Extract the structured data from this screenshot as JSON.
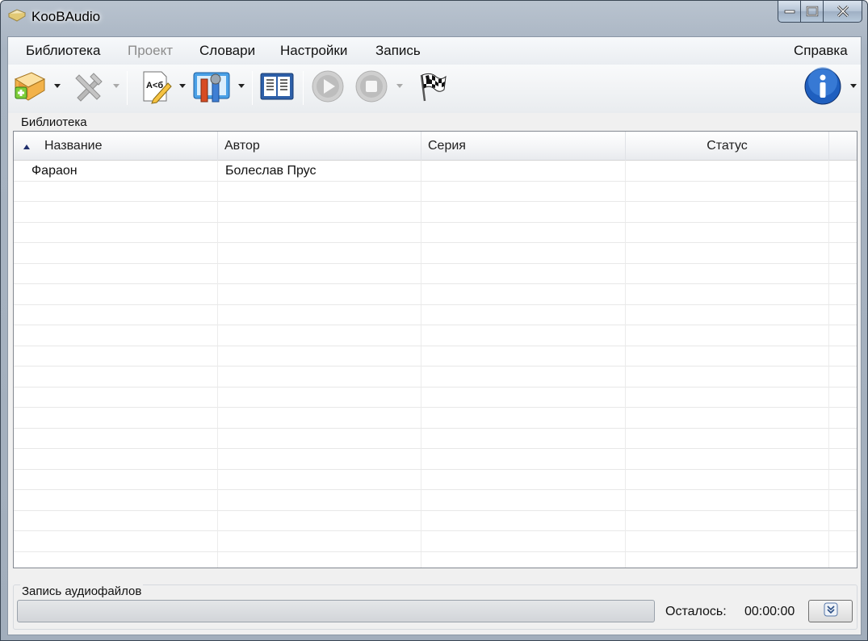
{
  "window": {
    "title": "KooBAudio"
  },
  "menu": {
    "library": "Библиотека",
    "project": "Проект",
    "dictionaries": "Словари",
    "settings": "Настройки",
    "record": "Запись",
    "help": "Справка"
  },
  "toolbar": {
    "icons": [
      "add-book-icon",
      "tools-icon",
      "edit-text-icon",
      "settings-icon",
      "book-icon",
      "play-icon",
      "stop-icon",
      "finish-flag-icon",
      "info-icon"
    ]
  },
  "library": {
    "group_label": "Библиотека",
    "columns": [
      "Название",
      "Автор",
      "Серия",
      "Статус"
    ],
    "rows": [
      {
        "title": "Фараон",
        "author": "Болеслав Прус",
        "series": "",
        "status": ""
      }
    ]
  },
  "recording": {
    "group_label": "Запись аудиофайлов",
    "progress": 0,
    "remaining_label": "Осталось:",
    "remaining_time": "00:00:00"
  },
  "colors": {
    "accent": "#1f5fbf",
    "window_frame": "#a8b4c2"
  }
}
